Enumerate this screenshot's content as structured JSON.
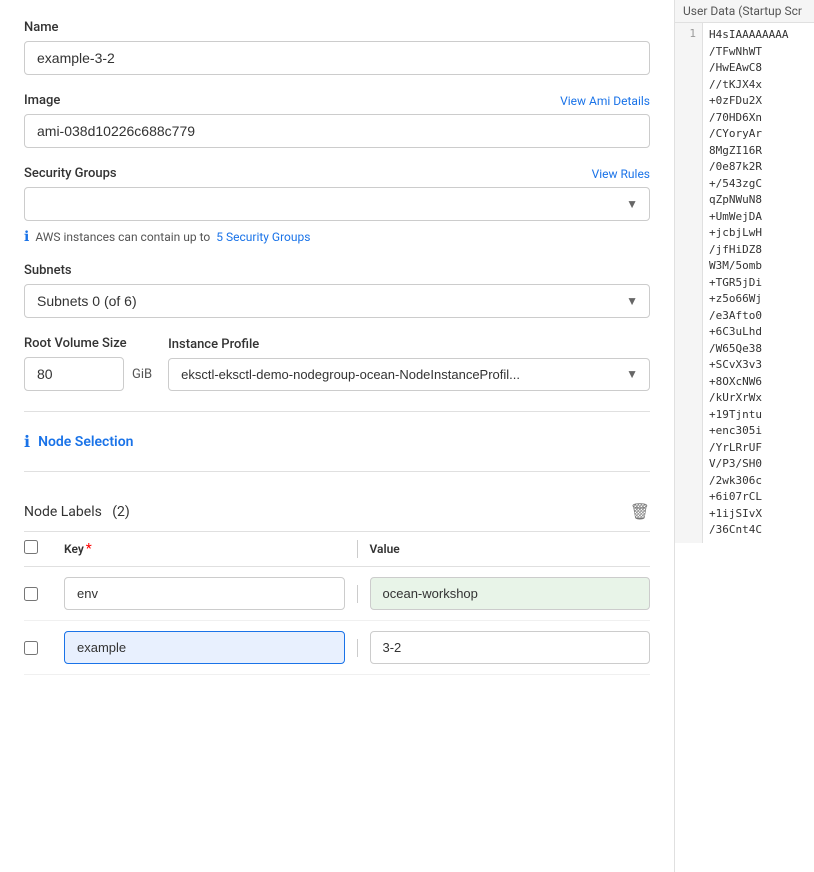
{
  "header": {
    "user_data_label": "User Data (Startup Scr"
  },
  "form": {
    "name_label": "Name",
    "name_value": "example-3-2",
    "image_label": "Image",
    "image_link": "View Ami Details",
    "image_value": "ami-038d10226c688c779",
    "security_groups_label": "Security Groups",
    "security_groups_link": "View Rules",
    "security_groups_placeholder": "",
    "security_info": "AWS instances can contain up to",
    "security_info_link": "5 Security Groups",
    "subnets_label": "Subnets",
    "subnets_placeholder": "Subnets 0 (of 6)",
    "root_volume_label": "Root Volume Size",
    "root_volume_value": "80",
    "gib_label": "GiB",
    "instance_profile_label": "Instance Profile",
    "instance_profile_value": "eksctl-eksctl-demo-nodegroup-ocean-NodeInstanceProfil..."
  },
  "node_selection": {
    "icon": "ℹ",
    "title": "Node Selection"
  },
  "node_labels": {
    "title": "Node Labels",
    "count": "(2)",
    "delete_icon": "🗑",
    "key_header": "Key",
    "required": "*",
    "value_header": "Value",
    "rows": [
      {
        "key": "env",
        "value": "ocean-workshop",
        "value_filled": true
      },
      {
        "key": "example",
        "value": "3-2",
        "value_filled": false
      }
    ]
  },
  "code_lines": [
    {
      "line": "1",
      "code": "H4sIAAAAAAAA"
    },
    {
      "line": "",
      "code": "/TFwNhWT"
    },
    {
      "line": "",
      "code": "/HwEAwC8"
    },
    {
      "line": "",
      "code": "//tKJX4x"
    },
    {
      "line": "",
      "code": "+0zFDu2X"
    },
    {
      "line": "",
      "code": "/70HD6Xn"
    },
    {
      "line": "",
      "code": "/CYoryAr"
    },
    {
      "line": "",
      "code": "8MgZI16R"
    },
    {
      "line": "",
      "code": "/0e87k2R"
    },
    {
      "line": "",
      "code": "+/543zgC"
    },
    {
      "line": "",
      "code": "qZpNWuN8"
    },
    {
      "line": "",
      "code": "+UmWejDA"
    },
    {
      "line": "",
      "code": "+jcbjLwH"
    },
    {
      "line": "",
      "code": "/jfHiDZ8"
    },
    {
      "line": "",
      "code": "W3M/5omb"
    },
    {
      "line": "",
      "code": "+TGR5jDi"
    },
    {
      "line": "",
      "code": "+z5o66Wj"
    },
    {
      "line": "",
      "code": "/e3Afto0"
    },
    {
      "line": "",
      "code": "+6C3uLhd"
    },
    {
      "line": "",
      "code": "/W65Qe38"
    },
    {
      "line": "",
      "code": "+SCvX3v3"
    },
    {
      "line": "",
      "code": "+8OXcNW6"
    },
    {
      "line": "",
      "code": "/kUrXrWx"
    },
    {
      "line": "",
      "code": "+19Tjntu"
    },
    {
      "line": "",
      "code": "+enc305i"
    },
    {
      "line": "",
      "code": "/YrLRrUF"
    },
    {
      "line": "",
      "code": "V/P3/SH0"
    },
    {
      "line": "",
      "code": "/2wk306c"
    },
    {
      "line": "",
      "code": "+6i07rCL"
    },
    {
      "line": "",
      "code": "+1ijSIvX"
    },
    {
      "line": "",
      "code": "/36Cnt4C"
    }
  ]
}
